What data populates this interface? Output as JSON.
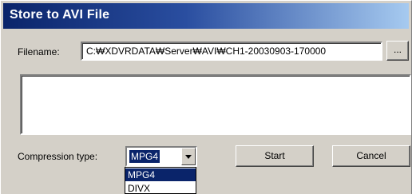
{
  "window": {
    "title": "Store to AVI File"
  },
  "filename": {
    "label": "Filename:",
    "value": "C:₩XDVRDATA₩Server₩AVI₩CH1-20030903-170000",
    "browse_label": "..."
  },
  "log": {
    "text": ""
  },
  "compression": {
    "label": "Compression type:",
    "selected": "MPG4",
    "options": [
      "MPG4",
      "DIVX"
    ]
  },
  "buttons": {
    "start": "Start",
    "cancel": "Cancel"
  },
  "colors": {
    "title_bar": "#0a246a",
    "dialog_bg": "#d4d0c8",
    "selection": "#0a246a"
  }
}
